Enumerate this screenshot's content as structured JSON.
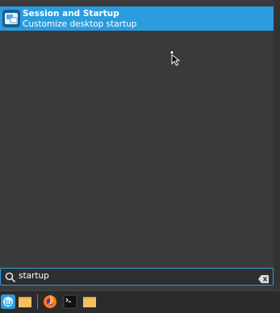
{
  "results": [
    {
      "title": "Session and Startup",
      "description": "Customize desktop startup",
      "icon": "session-startup-icon"
    }
  ],
  "search": {
    "value": "startup",
    "icon": "search-icon",
    "clear_icon": "clear-icon"
  },
  "taskbar": {
    "items": [
      {
        "name": "mint-menu",
        "icon": "mint-logo-icon"
      },
      {
        "name": "show-desktop",
        "icon": "folder-icon"
      },
      {
        "name": "firefox",
        "icon": "firefox-icon"
      },
      {
        "name": "terminal",
        "icon": "terminal-icon"
      },
      {
        "name": "files",
        "icon": "folder-icon"
      }
    ]
  },
  "colors": {
    "accent": "#2a9ce0",
    "menu_bg": "#3b3b3b",
    "taskbar_bg": "#2b2b2b"
  }
}
